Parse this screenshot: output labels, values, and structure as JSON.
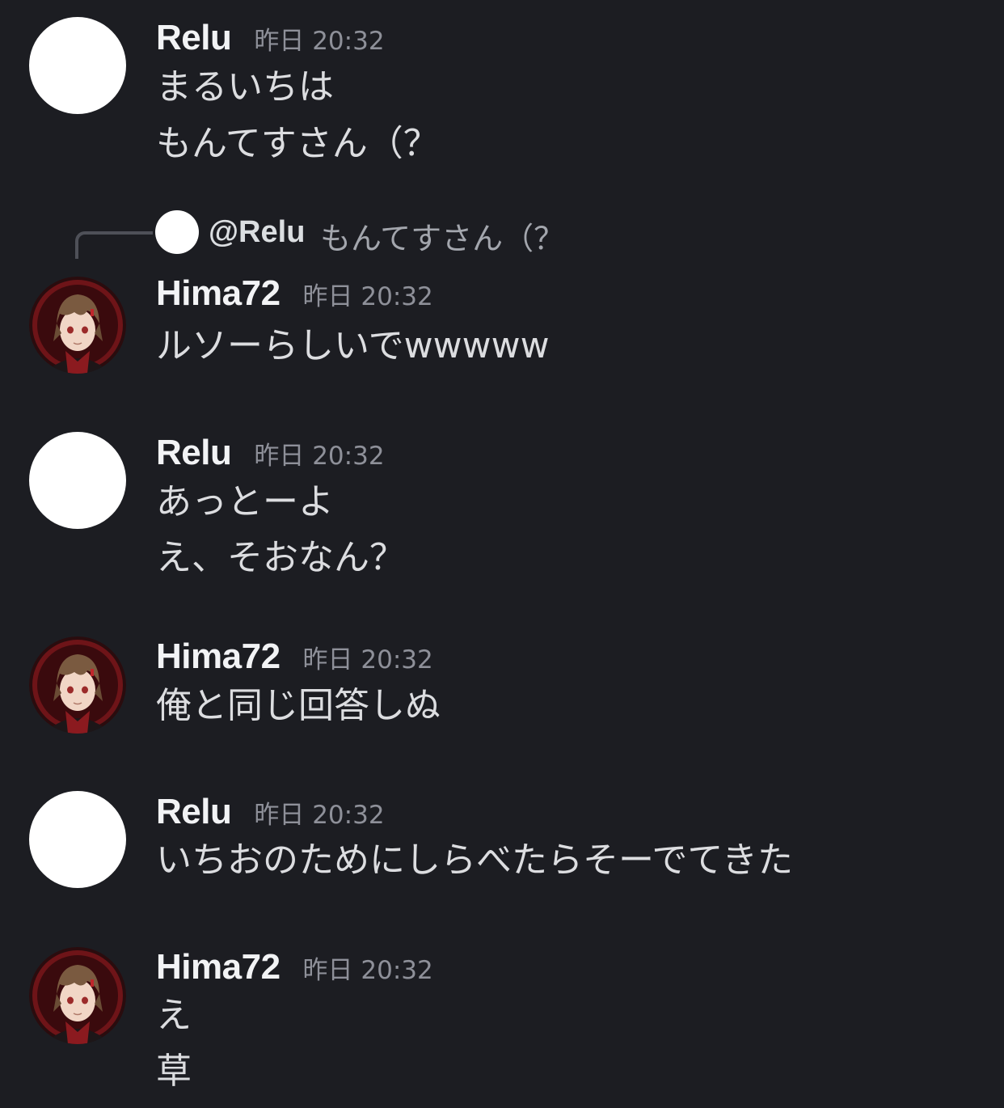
{
  "messages": [
    {
      "author": "Relu",
      "timestamp": "昨日 20:32",
      "avatar": "white-circle",
      "lines": [
        "まるいちは",
        "もんてすさん（？"
      ]
    },
    {
      "reply": {
        "mention": "@Relu",
        "preview": "もんてすさん（？"
      },
      "author": "Hima72",
      "timestamp": "昨日 20:32",
      "avatar": "anime-character",
      "lines": [
        "ルソーらしいでwwwww"
      ]
    },
    {
      "author": "Relu",
      "timestamp": "昨日 20:32",
      "avatar": "white-circle",
      "lines": [
        "あっとーよ",
        "え、そおなん？"
      ]
    },
    {
      "author": "Hima72",
      "timestamp": "昨日 20:32",
      "avatar": "anime-character",
      "lines": [
        "俺と同じ回答しぬ"
      ]
    },
    {
      "author": "Relu",
      "timestamp": "昨日 20:32",
      "avatar": "white-circle",
      "lines": [
        "いちおのためにしらべたらそーでてきた"
      ]
    },
    {
      "author": "Hima72",
      "timestamp": "昨日 20:32",
      "avatar": "anime-character",
      "lines": [
        "え",
        "草"
      ]
    }
  ],
  "colors": {
    "background": "#1c1d22",
    "username": "#f2f3f5",
    "timestamp": "#8e9099",
    "message_text": "#dcdde0",
    "reply_text": "#a3a6ad"
  }
}
